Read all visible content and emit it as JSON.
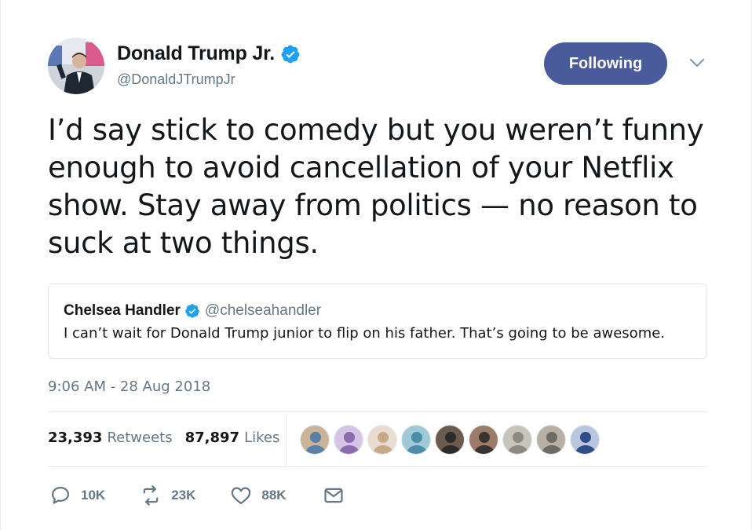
{
  "author": {
    "name": "Donald Trump Jr.",
    "handle": "@DonaldJTrumpJr",
    "verified": true,
    "avatar_icon": "user-photo"
  },
  "follow_button": {
    "label": "Following",
    "color": "#4a5b9c"
  },
  "tweet": {
    "text": "I’d say stick to comedy but you weren’t funny enough to avoid cancellation of your Netflix show. Stay away from politics — no reason to suck at two things.",
    "timestamp": "9:06 AM - 28 Aug 2018"
  },
  "quoted_tweet": {
    "name": "Chelsea Handler",
    "handle": "@chelseahandler",
    "verified": true,
    "text": "I can’t wait for Donald Trump junior to flip on his father. That’s going to be awesome."
  },
  "stats": {
    "retweets_count": "23,393",
    "retweets_label": "Retweets",
    "likes_count": "87,897",
    "likes_label": "Likes"
  },
  "liker_avatars": [
    {
      "colors": [
        "#5b7fa6",
        "#c9b49a"
      ]
    },
    {
      "colors": [
        "#8a6bb0",
        "#d7c3e6"
      ]
    },
    {
      "colors": [
        "#c7a98a",
        "#e9ddd0"
      ]
    },
    {
      "colors": [
        "#4c8da6",
        "#9ec9d6"
      ]
    },
    {
      "colors": [
        "#2b2b2b",
        "#6b5a4e"
      ]
    },
    {
      "colors": [
        "#3a3330",
        "#9b7c68"
      ]
    },
    {
      "colors": [
        "#8d8a84",
        "#c9c4ba"
      ]
    },
    {
      "colors": [
        "#6e6a64",
        "#b8b0a4"
      ]
    },
    {
      "colors": [
        "#2f4d86",
        "#b9c6de"
      ]
    }
  ],
  "actions": {
    "reply_count": "10K",
    "retweet_count": "23K",
    "like_count": "88K"
  },
  "colors": {
    "verified_blue": "#1da1f2",
    "secondary_text": "#657786",
    "border": "#e1e8ed"
  }
}
